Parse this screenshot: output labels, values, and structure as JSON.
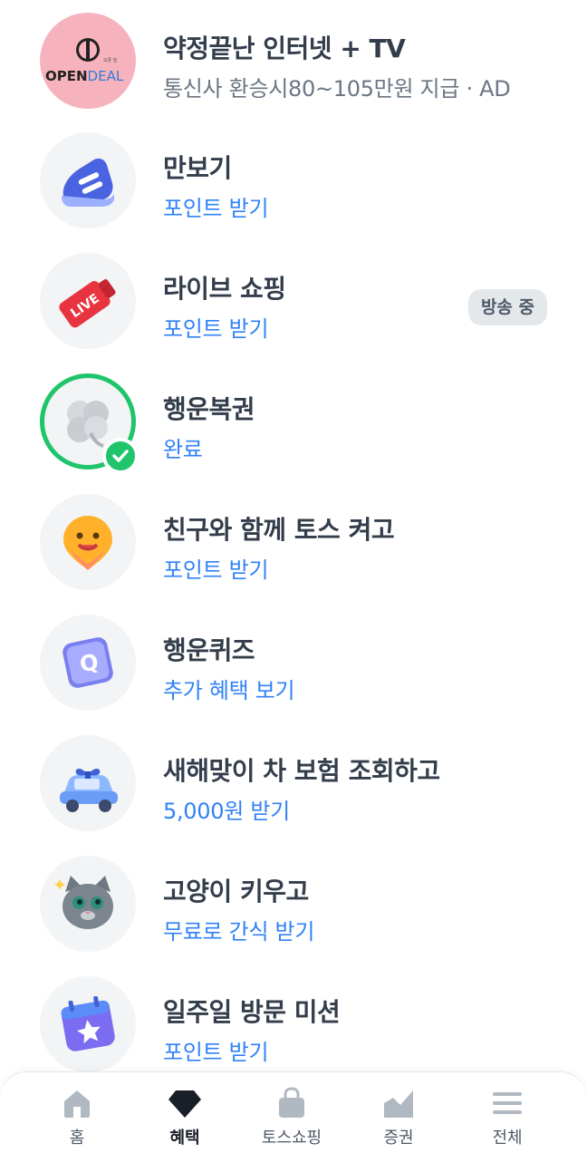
{
  "items": [
    {
      "title": "약정끝난 인터넷 + TV",
      "subtitle": "통신사 환승시80~105만원 지급 · AD",
      "icon": "opendeal-logo",
      "logo_text": "OPENDEAL",
      "logo_small": "오픈 딜"
    },
    {
      "title": "만보기",
      "subtitle": "포인트 받기",
      "icon": "sneaker-icon"
    },
    {
      "title": "라이브 쇼핑",
      "subtitle": "포인트 받기",
      "icon": "live-tag-icon",
      "badge": "방송 중",
      "tag_text": "LIVE"
    },
    {
      "title": "행운복권",
      "subtitle": "완료",
      "icon": "clover-icon",
      "completed": true
    },
    {
      "title": "친구와 함께 토스 켜고",
      "subtitle": "포인트 받기",
      "icon": "smiley-pin-icon"
    },
    {
      "title": "행운퀴즈",
      "subtitle": "추가 혜택 보기",
      "icon": "quiz-cube-icon",
      "cube_text": "Q"
    },
    {
      "title": " 새해맞이 차 보험 조회하고",
      "subtitle": "5,000원 받기",
      "icon": "gift-car-icon"
    },
    {
      "title": "고양이 키우고",
      "subtitle": "무료로 간식 받기",
      "icon": "cat-icon"
    },
    {
      "title": "일주일 방문 미션",
      "subtitle": "포인트 받기",
      "icon": "calendar-star-icon"
    }
  ],
  "tabbar": {
    "tabs": [
      {
        "label": "홈",
        "icon": "home-icon",
        "active": false
      },
      {
        "label": "혜택",
        "icon": "diamond-icon",
        "active": true
      },
      {
        "label": "토스쇼핑",
        "icon": "shopping-bag-icon",
        "active": false
      },
      {
        "label": "증권",
        "icon": "chart-icon",
        "active": false
      },
      {
        "label": "전체",
        "icon": "menu-icon",
        "active": false
      }
    ]
  },
  "colors": {
    "accent": "#3182f6",
    "title": "#333d4b",
    "complete_ring": "#20c46a",
    "ad_circle": "#f7b3bd"
  }
}
